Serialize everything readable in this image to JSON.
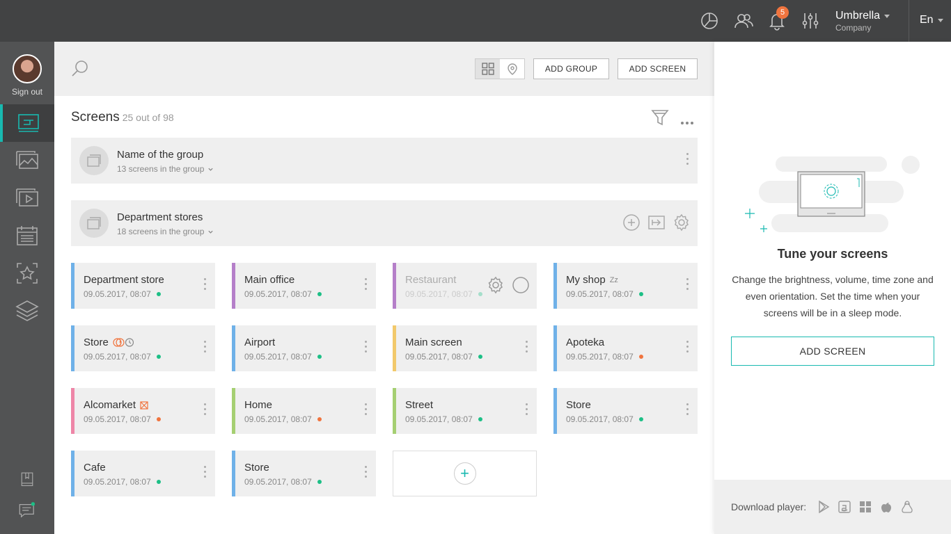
{
  "header": {
    "notification_count": "5",
    "company_name": "Umbrella",
    "company_sub": "Company",
    "language": "En",
    "icons": [
      "pie-chart-icon",
      "users-icon",
      "bell-icon",
      "sliders-icon"
    ]
  },
  "sidebar": {
    "sign_out": "Sign out",
    "items": [
      "screens-icon",
      "gallery-icon",
      "playlist-icon",
      "schedule-icon",
      "favorites-icon",
      "layers-icon"
    ],
    "bottom": [
      "guide-icon",
      "chat-icon"
    ]
  },
  "toolbar": {
    "add_group": "ADD GROUP",
    "add_screen": "ADD SCREEN"
  },
  "screens": {
    "title": "Screens",
    "count": "25 out of 98"
  },
  "groups": [
    {
      "name": "Name of the group",
      "sub": "13 screens in the group"
    },
    {
      "name": "Department stores",
      "sub": "18 screens in the group"
    }
  ],
  "cards": [
    {
      "name": "Department store",
      "date": "09.05.2017, 08:07",
      "status": "online",
      "accent": "#6fb1e8"
    },
    {
      "name": "Main office",
      "date": "09.05.2017, 08:07",
      "status": "online",
      "accent": "#b57fc9"
    },
    {
      "name": "Restaurant",
      "date": "09.05.2017, 08:07",
      "status": "online",
      "accent": "#b57fc9"
    },
    {
      "name": "My shop",
      "date": "09.05.2017, 08:07",
      "status": "online",
      "accent": "#6fb1e8",
      "badge": "Zz"
    },
    {
      "name": "Store",
      "date": "09.05.2017, 08:07",
      "status": "online",
      "accent": "#6fb1e8"
    },
    {
      "name": "Airport",
      "date": "09.05.2017, 08:07",
      "status": "online",
      "accent": "#6fb1e8"
    },
    {
      "name": "Main screen",
      "date": "09.05.2017, 08:07",
      "status": "online",
      "accent": "#f2c96b"
    },
    {
      "name": "Apoteka",
      "date": "09.05.2017, 08:07",
      "status": "warning",
      "accent": "#6fb1e8"
    },
    {
      "name": "Alcomarket",
      "date": "09.05.2017, 08:07",
      "status": "warning",
      "accent": "#ee86a8"
    },
    {
      "name": "Home",
      "date": "09.05.2017, 08:07",
      "status": "warning",
      "accent": "#a5cf72"
    },
    {
      "name": "Street",
      "date": "09.05.2017, 08:07",
      "status": "online",
      "accent": "#a5cf72"
    },
    {
      "name": "Store",
      "date": "09.05.2017, 08:07",
      "status": "online",
      "accent": "#6fb1e8"
    },
    {
      "name": "Cafe",
      "date": "09.05.2017, 08:07",
      "status": "online",
      "accent": "#6fb1e8"
    },
    {
      "name": "Store",
      "date": "09.05.2017, 08:07",
      "status": "online",
      "accent": "#6fb1e8"
    }
  ],
  "panel": {
    "title": "Tune your screens",
    "text": "Change the brightness, volume, time zone and even orientation. Set the time when your screens will be in a sleep mode.",
    "button": "ADD SCREEN",
    "download_label": "Download player:",
    "platforms": [
      "google-play-icon",
      "amazon-icon",
      "windows-icon",
      "apple-icon",
      "linux-icon"
    ]
  },
  "colors": {
    "accent": "#18b9b0",
    "topbar": "#424344",
    "sidebar": "#525354",
    "online": "#1dbf86",
    "warning": "#f0743e"
  }
}
